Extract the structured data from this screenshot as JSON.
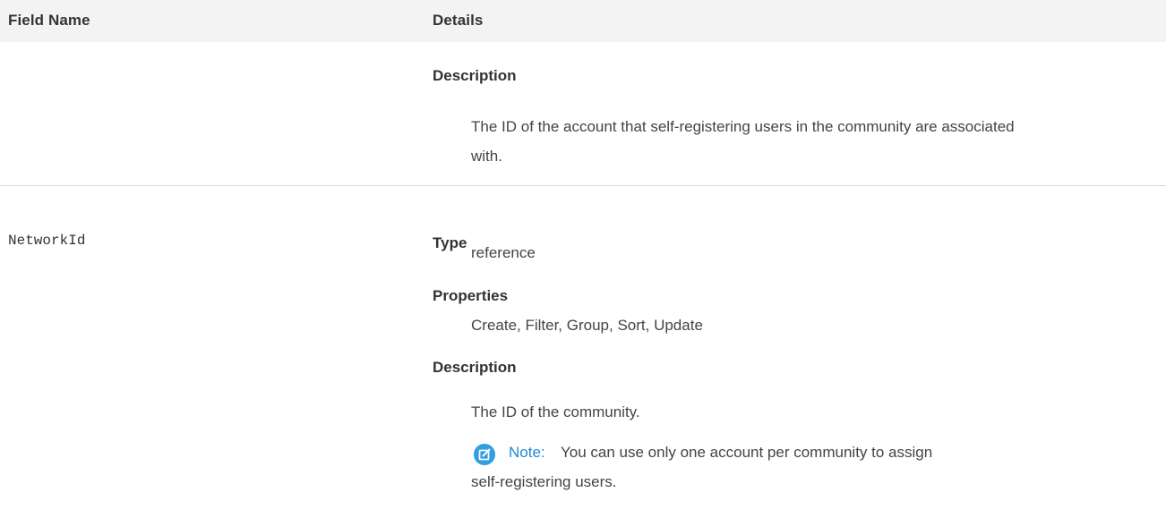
{
  "table": {
    "headers": {
      "field_name": "Field Name",
      "details": "Details"
    }
  },
  "previous_field": {
    "description_label": "Description",
    "description_line1": "The ID of the account that self-registering users in the community are associated",
    "description_line2": "with."
  },
  "network_field": {
    "name": "NetworkId",
    "type_label": "Type",
    "type_value": "reference",
    "properties_label": "Properties",
    "properties_value": "Create, Filter, Group, Sort, Update",
    "description_label": "Description",
    "description_value": "The ID of the community.",
    "note": {
      "icon": "note-edit-icon",
      "label": "Note:",
      "text_line1": "You can use only one account per community to assign",
      "text_line2": "self-registering users."
    }
  },
  "colors": {
    "header_bg": "#f3f3f3",
    "note_accent": "#1e8ad6",
    "note_icon_bg": "#2f9fe0",
    "divider": "#d8d8d8"
  }
}
